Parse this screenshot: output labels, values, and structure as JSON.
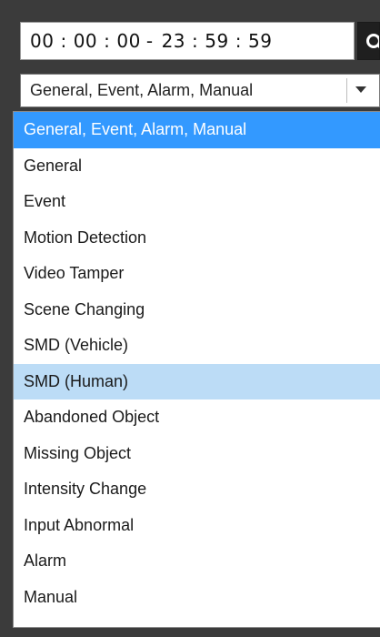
{
  "time_range": {
    "start_h": "00",
    "start_m": "00",
    "start_s": "00",
    "separator": ":",
    "dash": "-",
    "end_h": "23",
    "end_m": "59",
    "end_s": "59"
  },
  "search_button": {
    "icon": "search-icon"
  },
  "event_type_select": {
    "selected_value": "General, Event, Alarm, Manual",
    "options": [
      "General, Event, Alarm, Manual",
      "General",
      "Event",
      "Motion Detection",
      "Video Tamper",
      "Scene Changing",
      "SMD (Vehicle)",
      "SMD (Human)",
      "Abandoned Object",
      "Missing Object",
      "Intensity Change",
      "Input Abnormal",
      "Alarm",
      "Manual"
    ],
    "selected_index": 0,
    "hovered_index": 7
  },
  "colors": {
    "selected_bg": "#3399ff",
    "hover_bg": "#bcdcf6",
    "panel_bg": "#3b3b3b"
  }
}
